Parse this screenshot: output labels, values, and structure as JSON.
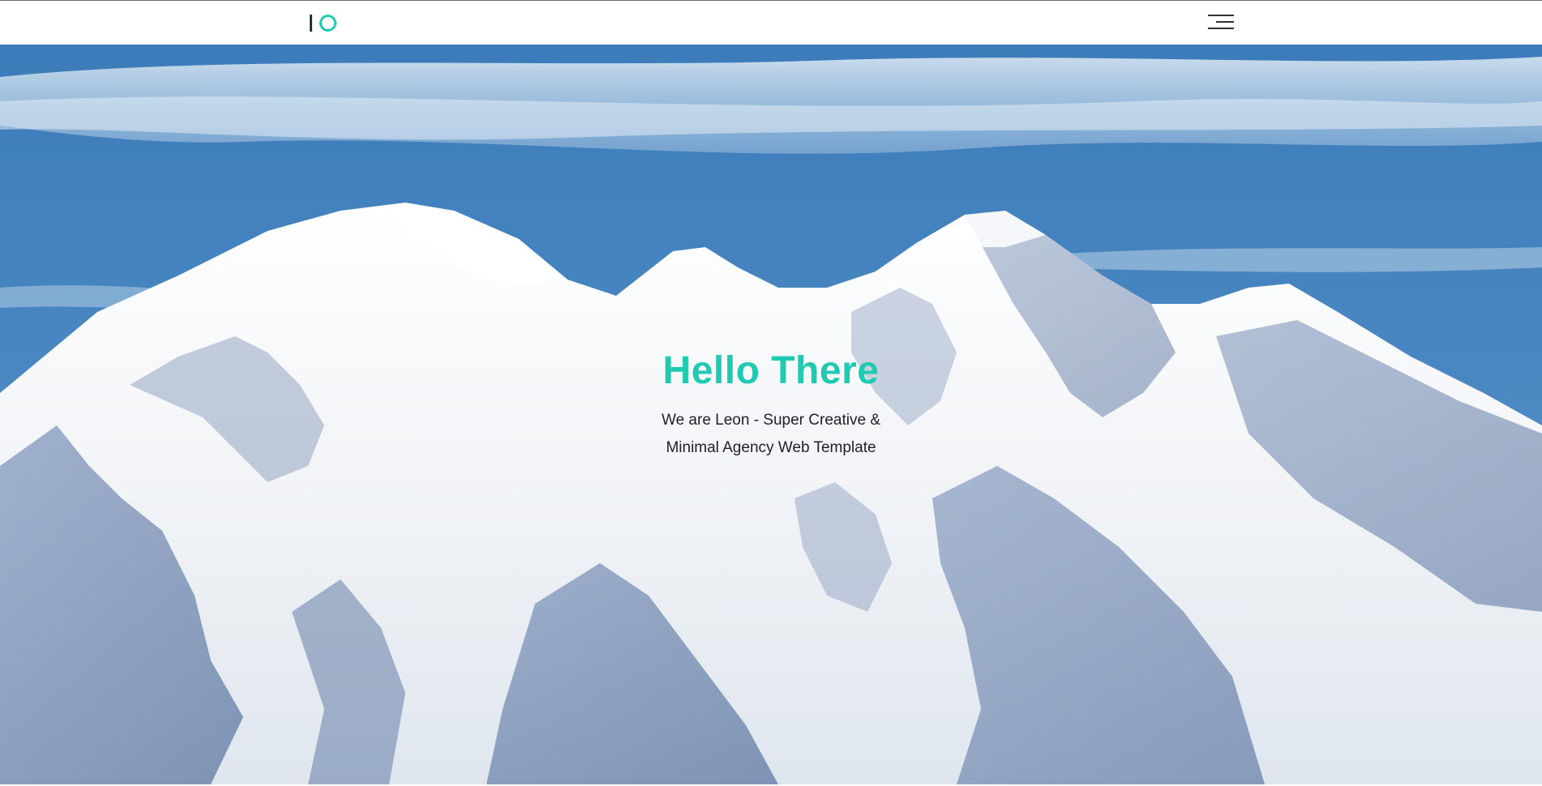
{
  "header": {
    "logo_icon": "io-logo-icon",
    "menu_icon": "hamburger-menu-icon"
  },
  "hero": {
    "title": "Hello There",
    "subtitle_line1": "We are Leon - Super Creative &",
    "subtitle_line2": "Minimal Agency Web Template",
    "background": "snow-capped-mountain-photo"
  },
  "colors": {
    "accent": "#1fcab0",
    "dark": "#2b3236",
    "sky": "#3f7fbc"
  }
}
